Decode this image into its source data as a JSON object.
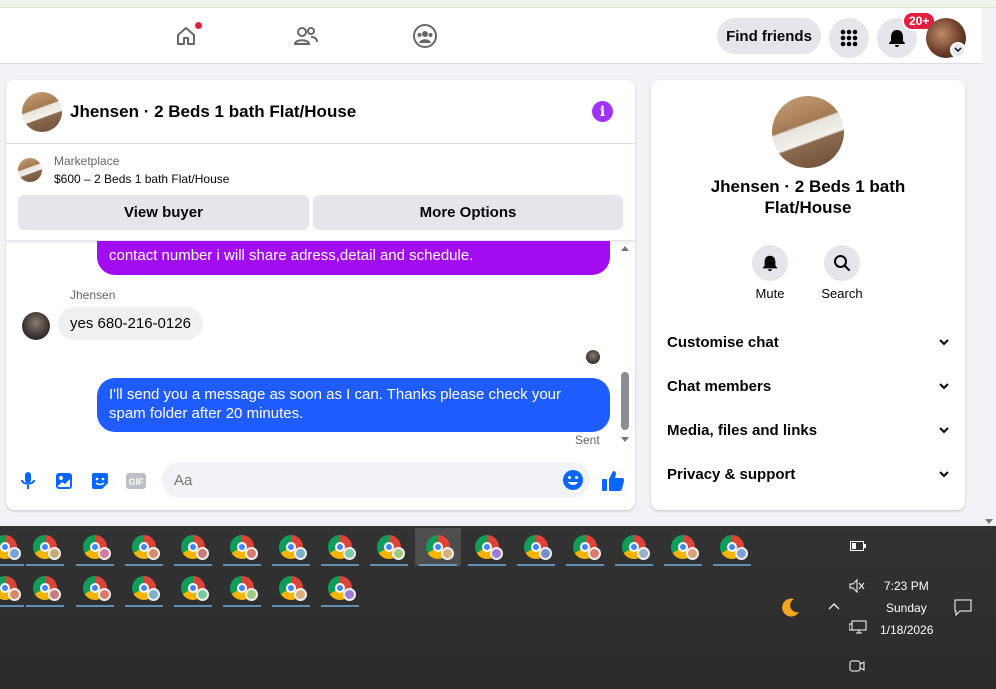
{
  "nav": {
    "find_friends": "Find friends",
    "notif_count": "20+",
    "icons": [
      "home-icon",
      "friends-icon",
      "groups-icon",
      "menu-grid-icon",
      "bell-icon"
    ]
  },
  "chat": {
    "title": "Jhensen · 2 Beds 1 bath Flat/House",
    "marketplace_label": "Marketplace",
    "listing_price": "$600 – 2 Beds 1 bath Flat/House",
    "view_buyer": "View buyer",
    "more_options": "More Options",
    "messages": {
      "purple_partial": "contact number i will share adress,detail and schedule.",
      "sender_name": "Jhensen",
      "friend_message": "yes 680-216-0126",
      "my_message": "I'll send you a message as soon as I can. Thanks please check your spam folder after 20 minutes.",
      "status": "Sent"
    },
    "composer_placeholder": "Aa"
  },
  "info_panel": {
    "title": "Jhensen · 2 Beds 1 bath Flat/House",
    "mute_label": "Mute",
    "search_label": "Search",
    "sections": [
      "Customise chat",
      "Chat members",
      "Media, files and links",
      "Privacy & support"
    ]
  },
  "taskbar": {
    "time": "7:23 PM",
    "day": "Sunday",
    "date": "1/18/2026"
  },
  "colors": {
    "accent_blue": "#1f5cff",
    "accent_purple": "#a10cf0",
    "info_purple": "#a033ff",
    "notification_red": "#e41e3f"
  }
}
